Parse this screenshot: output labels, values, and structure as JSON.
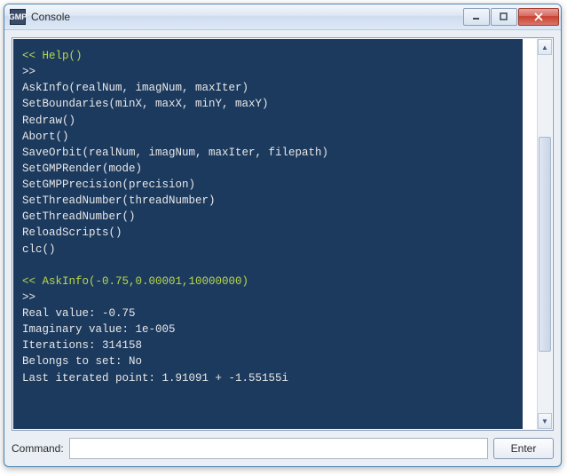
{
  "window": {
    "title": "Console",
    "app_icon_text": "GMP"
  },
  "console": {
    "cmd1": "<< Help()",
    "out1_prompt": ">>",
    "help_lines": [
      "AskInfo(realNum, imagNum, maxIter)",
      "SetBoundaries(minX, maxX, minY, maxY)",
      "Redraw()",
      "Abort()",
      "SaveOrbit(realNum, imagNum, maxIter, filepath)",
      "SetGMPRender(mode)",
      "SetGMPPrecision(precision)",
      "SetThreadNumber(threadNumber)",
      "GetThreadNumber()",
      "ReloadScripts()",
      "clc()"
    ],
    "cmd2": "<< AskInfo(-0.75,0.00001,10000000)",
    "out2_prompt": ">>",
    "info_lines": [
      "Real value: -0.75",
      "Imaginary value: 1e-005",
      "Iterations: 314158",
      "Belongs to set: No",
      "Last iterated point: 1.91091 + -1.55155i"
    ]
  },
  "bottombar": {
    "label": "Command:",
    "input_value": "",
    "enter_label": "Enter"
  }
}
